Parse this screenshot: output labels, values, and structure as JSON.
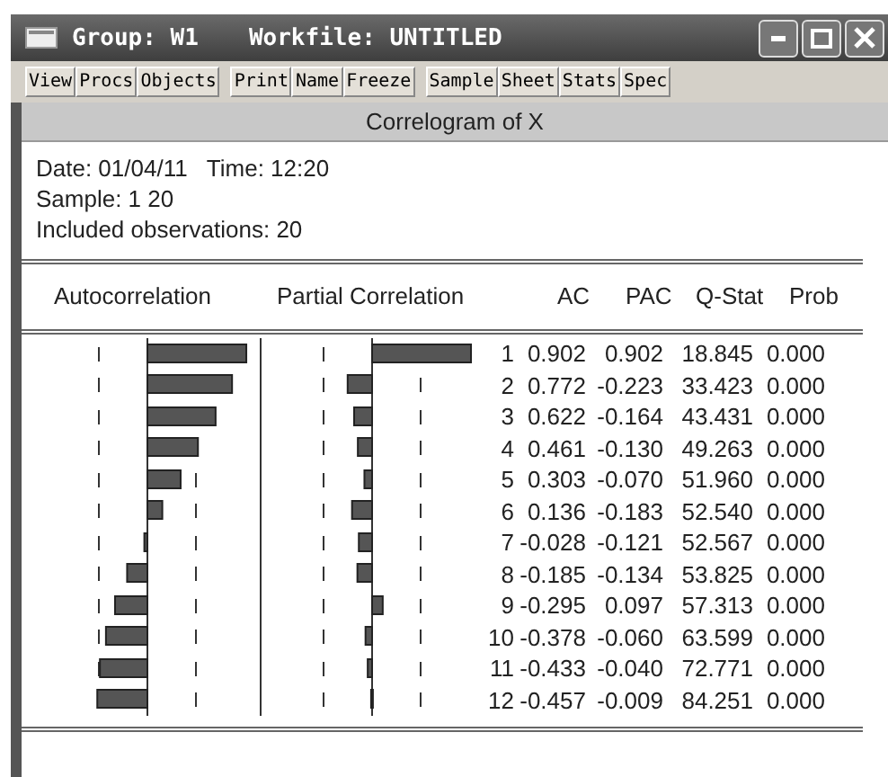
{
  "window": {
    "title_group": "Group: W1",
    "title_workfile": "Workfile: UNTITLED"
  },
  "toolbar": [
    [
      "View",
      "Procs",
      "Objects"
    ],
    [
      "Print",
      "Name",
      "Freeze"
    ],
    [
      "Sample",
      "Sheet",
      "Stats",
      "Spec"
    ]
  ],
  "view_title": "Correlogram of X",
  "info": [
    "Date: 01/04/11   Time: 12:20",
    "Sample: 1 20",
    "Included observations: 20"
  ],
  "columns": [
    "Autocorrelation",
    "Partial Correlation",
    "AC",
    "PAC",
    "Q-Stat",
    "Prob"
  ],
  "rows": [
    {
      "lag": "1",
      "ac": "0.902",
      "pac": "0.902",
      "q": "18.845",
      "prob": "0.000"
    },
    {
      "lag": "2",
      "ac": "0.772",
      "pac": "-0.223",
      "q": "33.423",
      "prob": "0.000"
    },
    {
      "lag": "3",
      "ac": "0.622",
      "pac": "-0.164",
      "q": "43.431",
      "prob": "0.000"
    },
    {
      "lag": "4",
      "ac": "0.461",
      "pac": "-0.130",
      "q": "49.263",
      "prob": "0.000"
    },
    {
      "lag": "5",
      "ac": "0.303",
      "pac": "-0.070",
      "q": "51.960",
      "prob": "0.000"
    },
    {
      "lag": "6",
      "ac": "0.136",
      "pac": "-0.183",
      "q": "52.540",
      "prob": "0.000"
    },
    {
      "lag": "7",
      "ac": "-0.028",
      "pac": "-0.121",
      "q": "52.567",
      "prob": "0.000"
    },
    {
      "lag": "8",
      "ac": "-0.185",
      "pac": "-0.134",
      "q": "53.825",
      "prob": "0.000"
    },
    {
      "lag": "9",
      "ac": "-0.295",
      "pac": "0.097",
      "q": "57.313",
      "prob": "0.000"
    },
    {
      "lag": "10",
      "ac": "-0.378",
      "pac": "-0.060",
      "q": "63.599",
      "prob": "0.000"
    },
    {
      "lag": "11",
      "ac": "-0.433",
      "pac": "-0.040",
      "q": "72.771",
      "prob": "0.000"
    },
    {
      "lag": "12",
      "ac": "-0.457",
      "pac": "-0.009",
      "q": "84.251",
      "prob": "0.000"
    }
  ]
}
